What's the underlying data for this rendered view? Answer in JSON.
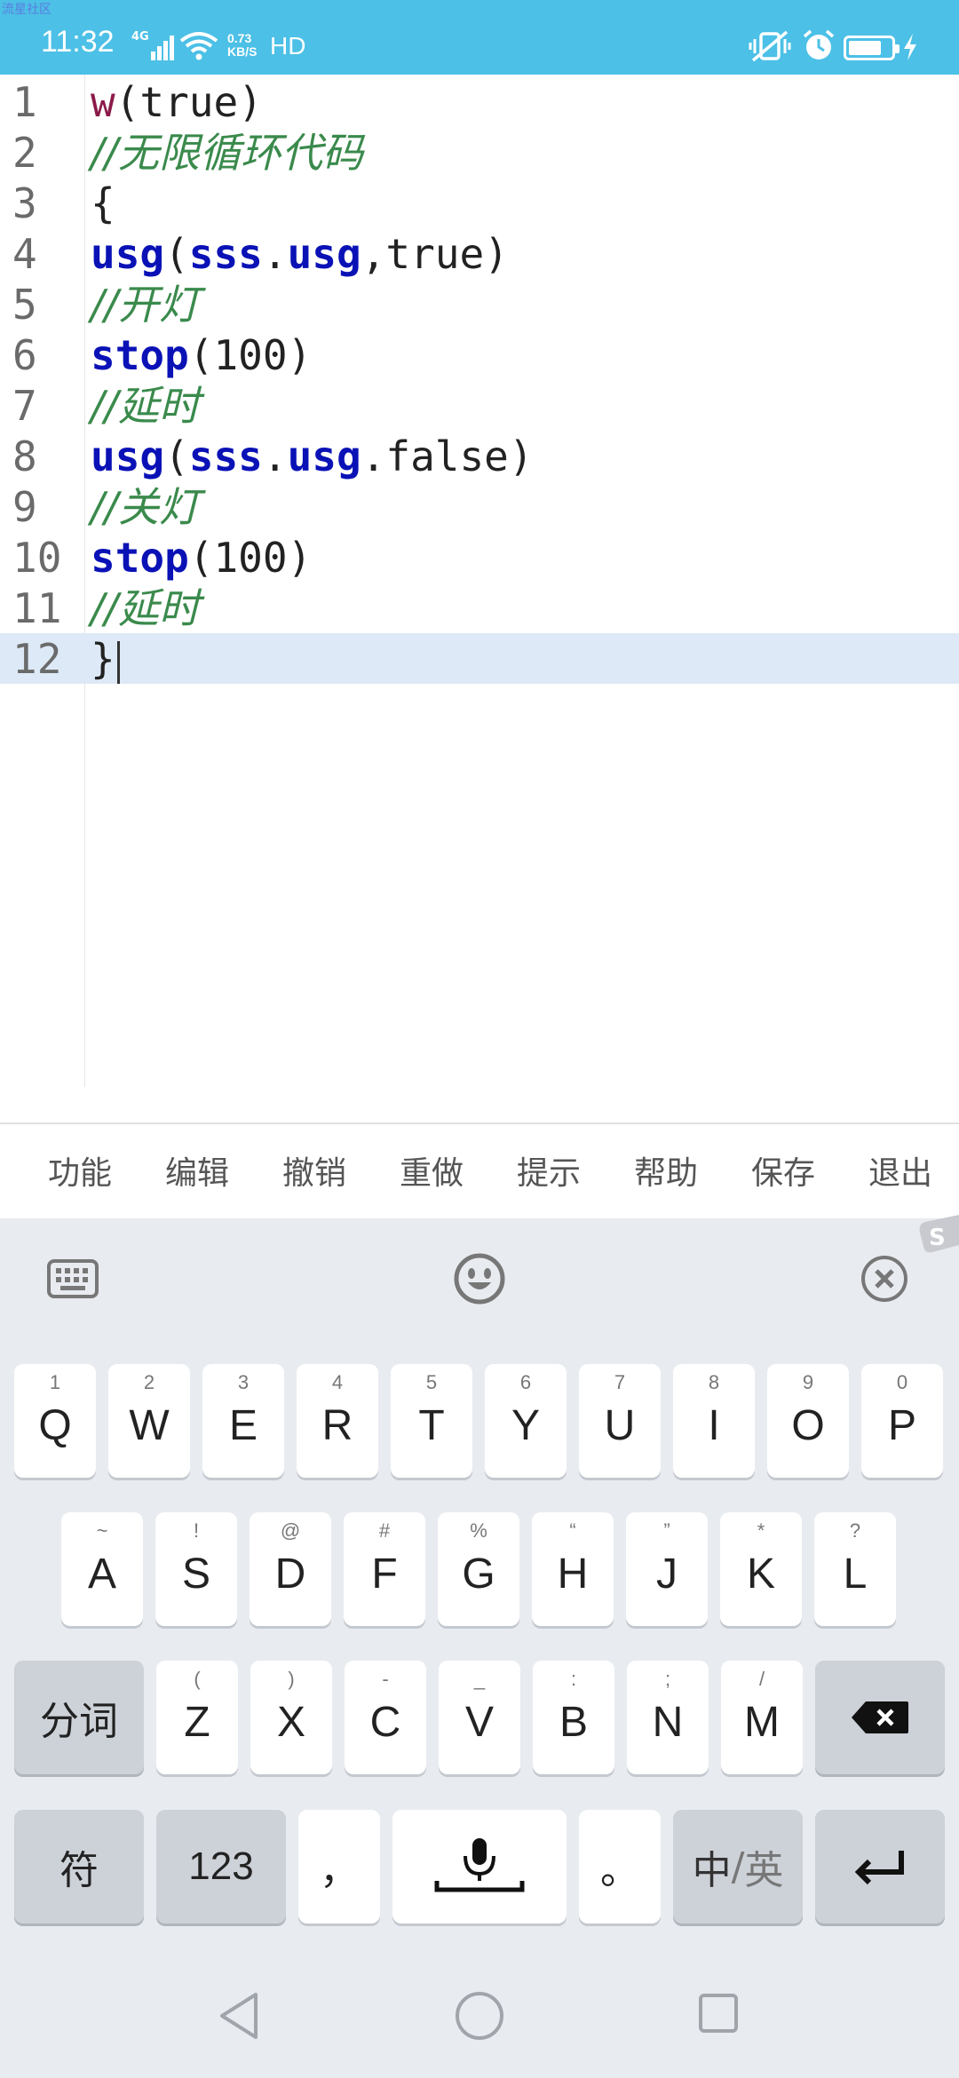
{
  "status_bar": {
    "watermark": "流星社区",
    "time": "11:32",
    "network": "4G",
    "speed_value": "0.73",
    "speed_unit": "KB/S",
    "hd": "HD",
    "colors": {
      "background": "#4cc0e6"
    }
  },
  "editor": {
    "lines": [
      {
        "num": "1",
        "tokens": [
          {
            "t": "w",
            "c": "tok-w"
          },
          {
            "t": "(true)",
            "c": "tok-p"
          }
        ]
      },
      {
        "num": "2",
        "tokens": [
          {
            "t": "//无限循环代码",
            "c": "tok-com"
          }
        ]
      },
      {
        "num": "3",
        "tokens": [
          {
            "t": "{",
            "c": "tok-p"
          }
        ]
      },
      {
        "num": "4",
        "tokens": [
          {
            "t": "usg",
            "c": "tok-kw"
          },
          {
            "t": "(",
            "c": "tok-p"
          },
          {
            "t": "sss",
            "c": "tok-kw"
          },
          {
            "t": ".",
            "c": "tok-p"
          },
          {
            "t": "usg",
            "c": "tok-kw"
          },
          {
            "t": ",true)",
            "c": "tok-p"
          }
        ]
      },
      {
        "num": "5",
        "tokens": [
          {
            "t": "//开灯",
            "c": "tok-com"
          }
        ]
      },
      {
        "num": "6",
        "tokens": [
          {
            "t": "stop",
            "c": "tok-kw"
          },
          {
            "t": "(100)",
            "c": "tok-p"
          }
        ]
      },
      {
        "num": "7",
        "tokens": [
          {
            "t": "//延时",
            "c": "tok-com"
          }
        ]
      },
      {
        "num": "8",
        "tokens": [
          {
            "t": "usg",
            "c": "tok-kw"
          },
          {
            "t": "(",
            "c": "tok-p"
          },
          {
            "t": "sss",
            "c": "tok-kw"
          },
          {
            "t": ".",
            "c": "tok-p"
          },
          {
            "t": "usg",
            "c": "tok-kw"
          },
          {
            "t": ".false)",
            "c": "tok-p"
          }
        ]
      },
      {
        "num": "9",
        "tokens": [
          {
            "t": "//关灯",
            "c": "tok-com"
          }
        ]
      },
      {
        "num": "10",
        "tokens": [
          {
            "t": "stop",
            "c": "tok-kw"
          },
          {
            "t": "(100)",
            "c": "tok-p"
          }
        ]
      },
      {
        "num": "11",
        "tokens": [
          {
            "t": "//延时",
            "c": "tok-com"
          }
        ]
      },
      {
        "num": "12",
        "tokens": [
          {
            "t": "}",
            "c": "tok-p"
          }
        ],
        "active": true
      }
    ],
    "colors": {
      "keyword": "#0a12b6",
      "comment": "#3a8a4c",
      "w_token": "#8b1a4a",
      "active_line": "#dde9f6"
    }
  },
  "toolbar": {
    "items": [
      "功能",
      "编辑",
      "撤销",
      "重做",
      "提示",
      "帮助",
      "保存",
      "退出"
    ]
  },
  "keyboard": {
    "top_icons": [
      "keyboard-icon",
      "emoji-icon",
      "close-circle-icon"
    ],
    "row1": [
      {
        "hint": "1",
        "key": "Q"
      },
      {
        "hint": "2",
        "key": "W"
      },
      {
        "hint": "3",
        "key": "E"
      },
      {
        "hint": "4",
        "key": "R"
      },
      {
        "hint": "5",
        "key": "T"
      },
      {
        "hint": "6",
        "key": "Y"
      },
      {
        "hint": "7",
        "key": "U"
      },
      {
        "hint": "8",
        "key": "I"
      },
      {
        "hint": "9",
        "key": "O"
      },
      {
        "hint": "0",
        "key": "P"
      }
    ],
    "row2": [
      {
        "hint": "~",
        "key": "A"
      },
      {
        "hint": "!",
        "key": "S"
      },
      {
        "hint": "@",
        "key": "D"
      },
      {
        "hint": "#",
        "key": "F"
      },
      {
        "hint": "%",
        "key": "G"
      },
      {
        "hint": "“",
        "key": "H"
      },
      {
        "hint": "”",
        "key": "J"
      },
      {
        "hint": "*",
        "key": "K"
      },
      {
        "hint": "?",
        "key": "L"
      }
    ],
    "row3_left": "分词",
    "row3": [
      {
        "hint": "(",
        "key": "Z"
      },
      {
        "hint": ")",
        "key": "X"
      },
      {
        "hint": "-",
        "key": "C"
      },
      {
        "hint": "_",
        "key": "V"
      },
      {
        "hint": ":",
        "key": "B"
      },
      {
        "hint": ";",
        "key": "N"
      },
      {
        "hint": "/",
        "key": "M"
      }
    ],
    "row4": {
      "symbols": "符",
      "numbers": "123",
      "comma": "，",
      "period": "。",
      "lang_zh": "中",
      "lang_sep": "/",
      "lang_en": "英"
    }
  }
}
